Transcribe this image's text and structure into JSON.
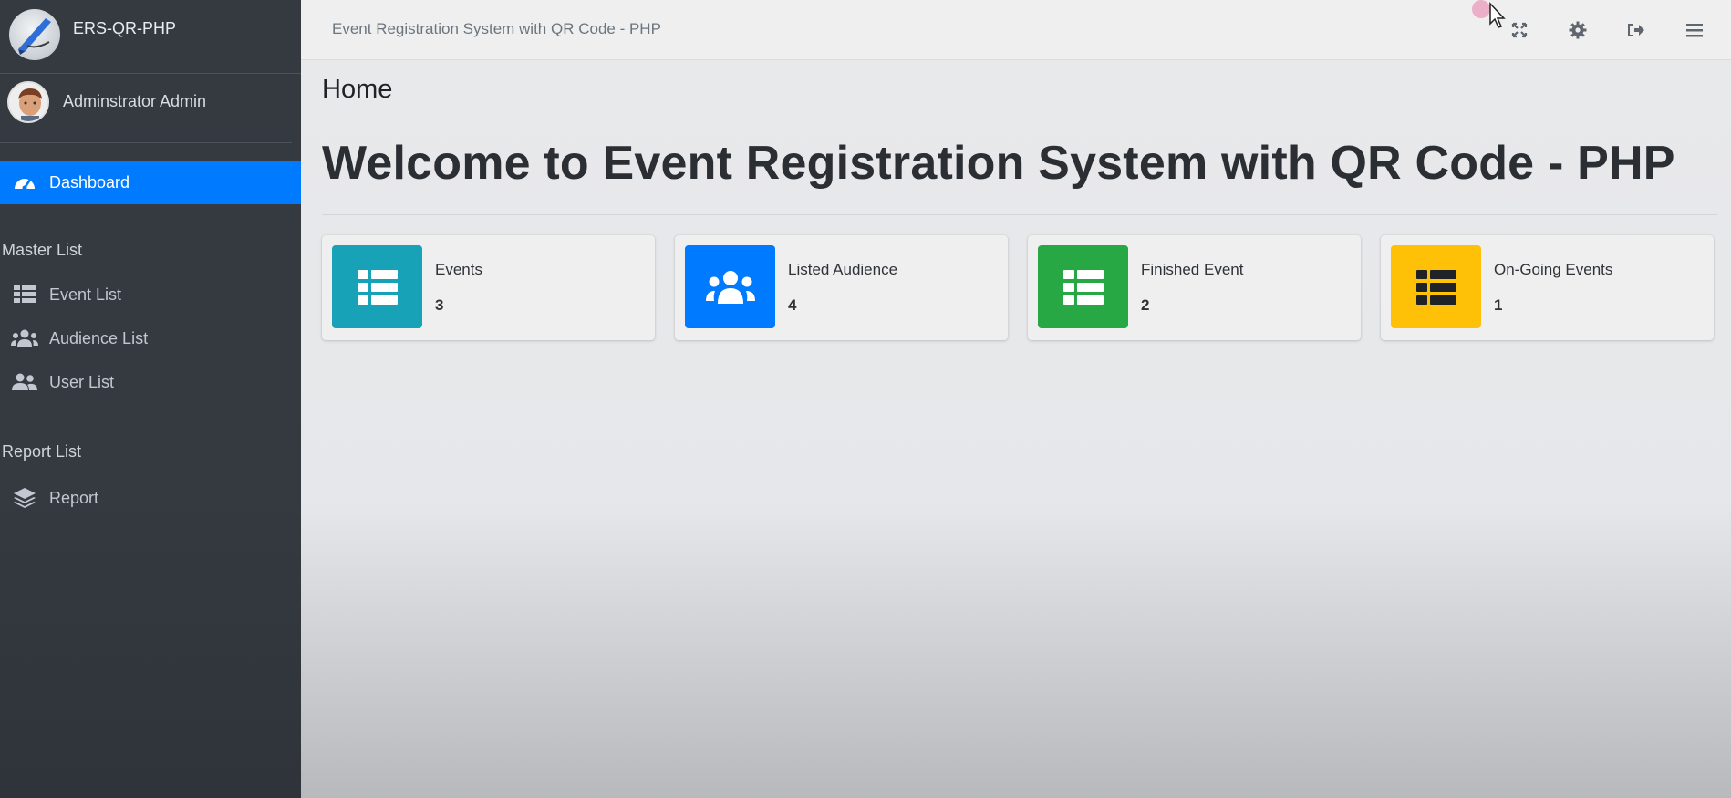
{
  "brand": {
    "name": "ERS-QR-PHP"
  },
  "user": {
    "name": "Adminstrator Admin"
  },
  "sidebar": {
    "dashboard": "Dashboard",
    "master_header": "Master List",
    "master_items": [
      {
        "label": "Event List",
        "icon": "table-icon"
      },
      {
        "label": "Audience List",
        "icon": "users-icon"
      },
      {
        "label": "User List",
        "icon": "user-friends-icon"
      }
    ],
    "report_header": "Report List",
    "report_items": [
      {
        "label": "Report",
        "icon": "layers-icon"
      }
    ]
  },
  "topbar": {
    "title": "Event Registration System with QR Code - PHP",
    "icons": [
      "expand-icon",
      "gear-icon",
      "logout-icon",
      "menu-icon"
    ]
  },
  "main": {
    "page_title": "Home",
    "welcome": "Welcome to Event Registration System with QR Code - PHP",
    "cards": [
      {
        "label": "Events",
        "value": "3",
        "color": "#17a2b8",
        "icon": "table-icon"
      },
      {
        "label": "Listed Audience",
        "value": "4",
        "color": "#007bff",
        "icon": "users-icon"
      },
      {
        "label": "Finished Event",
        "value": "2",
        "color": "#28a745",
        "icon": "table-icon"
      },
      {
        "label": "On-Going Events",
        "value": "1",
        "color": "#ffc107",
        "icon": "table-icon"
      }
    ]
  },
  "colors": {
    "sidebar": "#343a40",
    "active": "#007bff"
  }
}
